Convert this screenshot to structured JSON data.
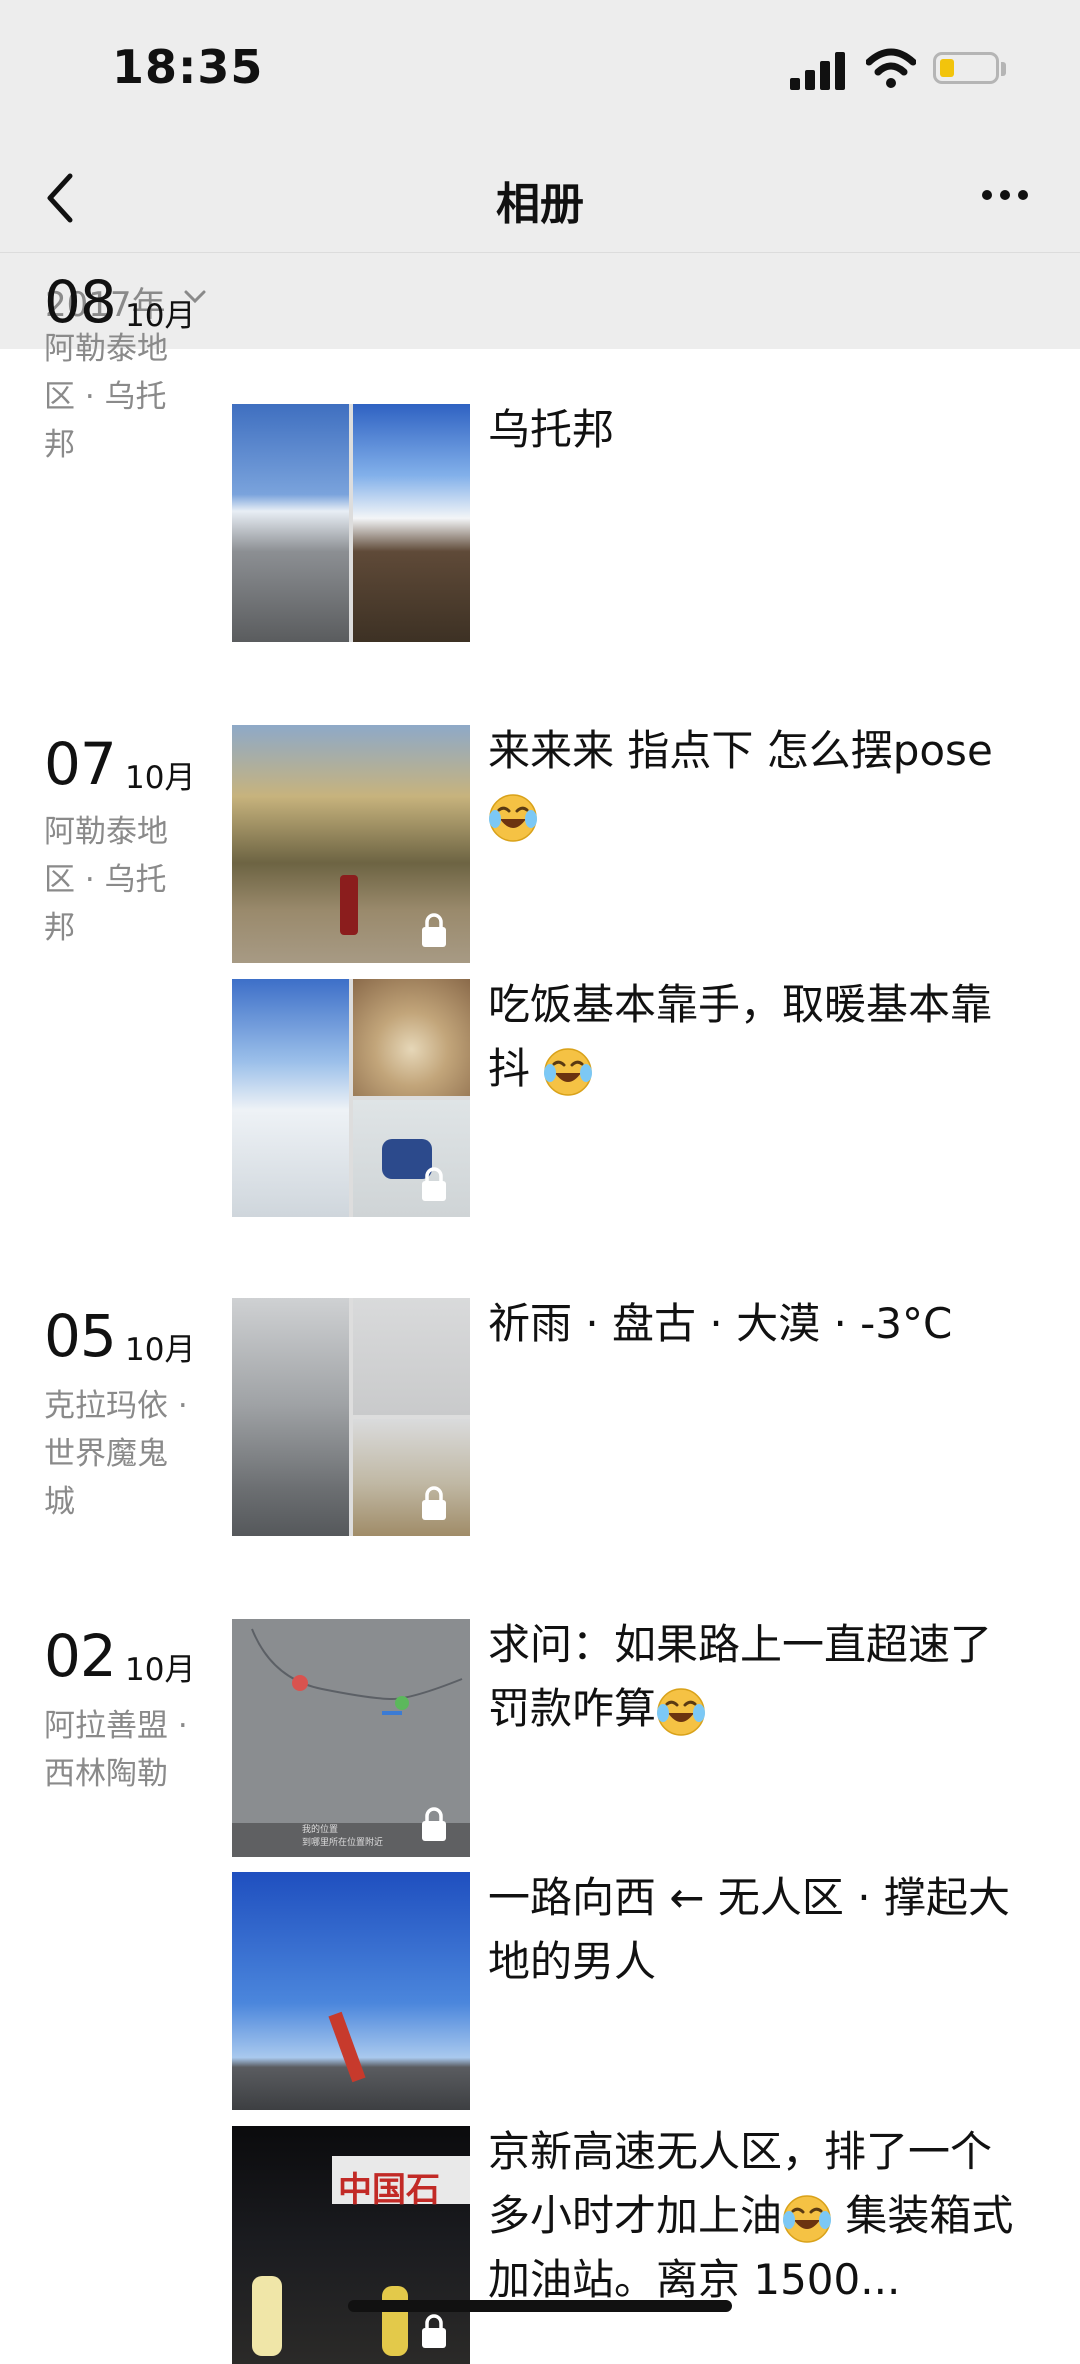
{
  "status": {
    "time": "18:35"
  },
  "nav": {
    "title": "相册"
  },
  "year_selector": {
    "label": "2017年"
  },
  "groups": [
    {
      "day": "08",
      "month": "10月",
      "location": "阿勒泰地区 · 乌托邦",
      "posts": [
        {
          "caption": "乌托邦",
          "emoji": false
        }
      ]
    },
    {
      "day": "07",
      "month": "10月",
      "location": "阿勒泰地区 · 乌托邦",
      "posts": [
        {
          "caption": "来来来 指点下 怎么摆pose",
          "emoji": true
        },
        {
          "caption": "吃饭基本靠手，取暖基本靠抖 ",
          "emoji": true
        }
      ]
    },
    {
      "day": "05",
      "month": "10月",
      "location": "克拉玛依 · 世界魔鬼城",
      "posts": [
        {
          "caption": "祈雨 · 盘古 · 大漠 · -3°C",
          "emoji": false
        }
      ]
    },
    {
      "day": "02",
      "month": "10月",
      "location": "阿拉善盟 · 西林陶勒",
      "posts": [
        {
          "caption": "求问：如果路上一直超速了 罚款咋算",
          "emoji": true
        },
        {
          "caption": "一路向西 ← 无人区 · 撑起大地的男人",
          "emoji": false
        },
        {
          "caption_part1": "京新高速无人区，排了一个多小时才加上油",
          "caption_part2": " 集装箱式加油站。离京 1500...",
          "emoji": true
        }
      ]
    }
  ],
  "map_thumb_labels": {
    "line1": "我的位置",
    "line2": "到哪里所在位置附近"
  },
  "fuel_sign": "中国石",
  "colors": {
    "bar_bg": "#ededed",
    "secondary_text": "#8a8a8a",
    "accent_emoji": "#f5c244"
  },
  "icons": [
    "back-chevron-icon",
    "more-icon",
    "chevron-down-icon",
    "lock-icon",
    "laughing-crying-emoji-icon"
  ]
}
